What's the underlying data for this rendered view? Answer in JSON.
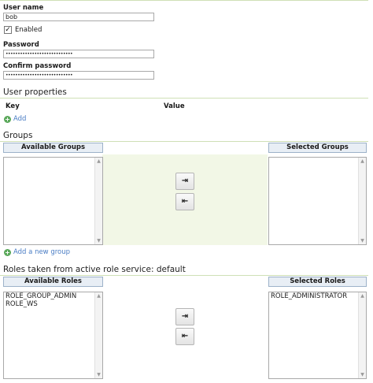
{
  "user": {
    "username_label": "User name",
    "username_value": "bob",
    "enabled_label": "Enabled",
    "enabled_checked": true,
    "password_label": "Password",
    "password_value": "••••••••••••••••••••••••••••",
    "confirm_label": "Confirm password",
    "confirm_value": "••••••••••••••••••••••••••••"
  },
  "properties": {
    "title": "User properties",
    "key_header": "Key",
    "value_header": "Value",
    "add_label": "Add"
  },
  "groups": {
    "title": "Groups",
    "available_header": "Available Groups",
    "selected_header": "Selected Groups",
    "available": [],
    "selected": [],
    "add_group_label": "Add a new group"
  },
  "roles": {
    "title": "Roles taken from active role service: default",
    "available_header": "Available Roles",
    "selected_header": "Selected Roles",
    "available": [
      "ROLE_GROUP_ADMIN",
      "ROLE_WS"
    ],
    "selected": [
      "ROLE_ADMINISTRATOR"
    ]
  },
  "icons": {
    "move_right": "⇥",
    "move_left": "⇤",
    "add": "+",
    "check": "✓",
    "scroll_up": "▲",
    "scroll_down": "▼"
  },
  "colors": {
    "accent_line": "#cfe0b6",
    "panel_bg": "#f2f7e6",
    "link": "#4a7dc4",
    "add_icon": "#5aa85a"
  }
}
